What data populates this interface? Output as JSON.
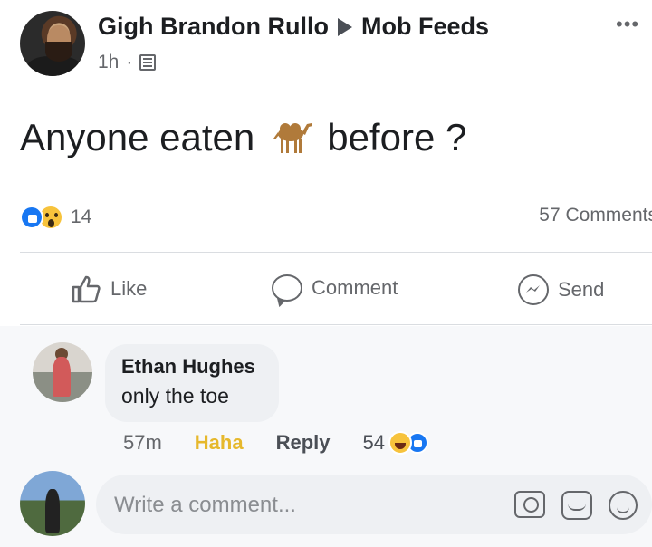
{
  "post": {
    "author": "Gigh Brandon Rullo",
    "group": "Mob Feeds",
    "time": "1h",
    "text_before": "Anyone eaten",
    "emoji": "camel-icon",
    "text_after": "before ?",
    "reaction_count": "14",
    "comments_count": "57 Comments"
  },
  "actions": {
    "like": "Like",
    "comment": "Comment",
    "send": "Send"
  },
  "comment": {
    "author": "Ethan Hughes",
    "text": "only the toe",
    "time": "57m",
    "reaction_label": "Haha",
    "reply": "Reply",
    "reaction_count": "54"
  },
  "composer": {
    "placeholder": "Write a comment..."
  },
  "colors": {
    "like_blue": "#1877f2",
    "haha_yellow": "#e6b82c",
    "text_secondary": "#65676b"
  }
}
